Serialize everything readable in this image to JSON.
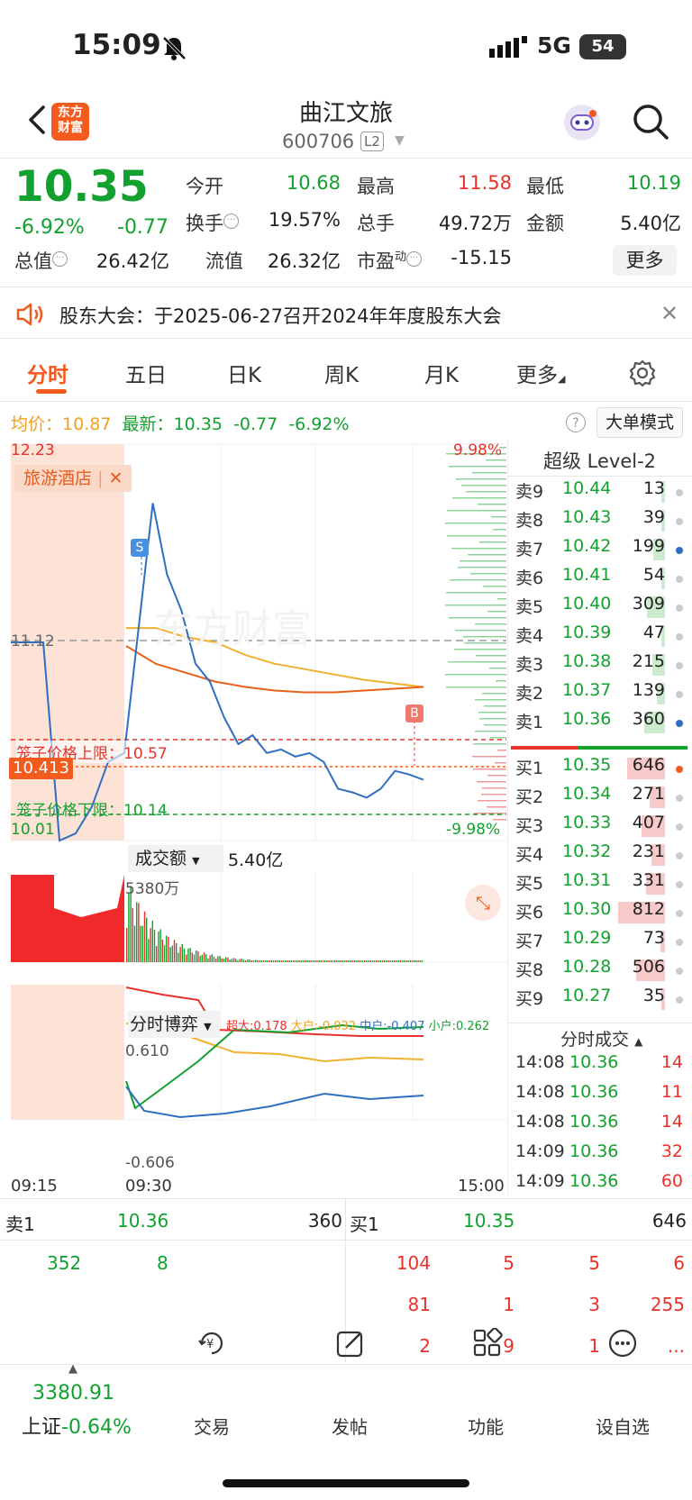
{
  "status_bar": {
    "time": "15:09",
    "network": "5G",
    "battery": "54"
  },
  "header": {
    "logo": "东方\n财富",
    "name": "曲江文旅",
    "code": "600706",
    "level_badge": "L2"
  },
  "quote": {
    "price": "10.35",
    "change_pct": "-6.92%",
    "change_abs": "-0.77",
    "open_label": "今开",
    "open": "10.68",
    "high_label": "最高",
    "high": "11.58",
    "low_label": "最低",
    "low": "10.19",
    "turnover_label": "换手",
    "turnover": "19.57%",
    "volume_label": "总手",
    "volume": "49.72万",
    "amount_label": "金额",
    "amount": "5.40亿",
    "mktcap_label": "总值",
    "mktcap": "26.42亿",
    "float_label": "流值",
    "float_cap": "26.32亿",
    "pe_label": "市盈",
    "pe_sup": "动",
    "pe": "-15.15",
    "more_label": "更多"
  },
  "notice": {
    "text": "股东大会：于2025-06-27召开2024年年度股东大会"
  },
  "tabs": [
    "分时",
    "五日",
    "日K",
    "周K",
    "月K",
    "更多"
  ],
  "active_tab": 0,
  "info_line": {
    "avg_label": "均价：",
    "avg": "10.87",
    "latest_label": "最新：",
    "latest": "10.35",
    "chg": "-0.77",
    "pct": "-6.92%",
    "big_order_mode": "大单模式"
  },
  "chart": {
    "y_top": "12.23",
    "y_bottom": "10.01",
    "ref_price": "11.12",
    "cur_tag": "10.413",
    "pct_top": "9.98%",
    "pct_bottom": "-9.98%",
    "cage_upper": "笼子价格上限：10.57",
    "cage_lower": "笼子价格下限：10.14",
    "sector_tag": "旅游酒店",
    "marker_s": "S",
    "marker_b": "B",
    "volume_title": "成交额",
    "volume_total": "5.40亿",
    "volume_max": "5380万",
    "game_title": "分时博弈",
    "game_legend": {
      "super": "超大:0.178",
      "large": "大户:-0.032",
      "mid": "中户:-0.407",
      "small": "小户:0.262"
    },
    "game_top": "0.610",
    "game_bottom": "-0.606",
    "time_start": "09:15",
    "time_open": "09:30",
    "time_end": "15:00"
  },
  "chart_data": {
    "type": "line",
    "title": "",
    "xlabel": "",
    "ylabel": "",
    "x_range": [
      "09:15",
      "15:00"
    ],
    "ylim": [
      10.01,
      12.23
    ],
    "series": [
      {
        "name": "",
        "color": "#2f6fc2",
        "values": [
          11.12,
          11.12,
          11.12,
          10.01,
          10.05,
          10.2,
          10.45,
          10.5,
          11.2,
          11.9,
          11.5,
          11.3,
          11.0,
          10.9,
          10.7,
          10.55,
          10.6,
          10.5,
          10.52,
          10.48,
          10.5,
          10.45,
          10.3,
          10.28,
          10.25,
          10.3,
          10.4,
          10.38,
          10.35
        ]
      },
      {
        "name": "",
        "color": "#f0b030",
        "values": [
          11.2,
          11.2,
          11.15,
          11.12,
          11.05,
          11.0,
          10.97,
          10.94,
          10.91,
          10.89,
          10.87
        ]
      },
      {
        "name": "",
        "color": "#e8601a",
        "values": [
          11.1,
          11.0,
          10.95,
          10.9,
          10.87,
          10.85,
          10.84,
          10.84,
          10.85,
          10.86,
          10.87
        ]
      }
    ]
  },
  "level2": {
    "title": "超级 Level-2",
    "asks": [
      {
        "label": "卖9",
        "price": "10.44",
        "vol": "13",
        "bar": 0.02
      },
      {
        "label": "卖8",
        "price": "10.43",
        "vol": "39",
        "bar": 0.05
      },
      {
        "label": "卖7",
        "price": "10.42",
        "vol": "199",
        "bar": 0.25
      },
      {
        "label": "卖6",
        "price": "10.41",
        "vol": "54",
        "bar": 0.07
      },
      {
        "label": "卖5",
        "price": "10.40",
        "vol": "309",
        "bar": 0.38
      },
      {
        "label": "卖4",
        "price": "10.39",
        "vol": "47",
        "bar": 0.06
      },
      {
        "label": "卖3",
        "price": "10.38",
        "vol": "215",
        "bar": 0.27
      },
      {
        "label": "卖2",
        "price": "10.37",
        "vol": "139",
        "bar": 0.17
      },
      {
        "label": "卖1",
        "price": "10.36",
        "vol": "360",
        "bar": 0.44
      }
    ],
    "bids": [
      {
        "label": "买1",
        "price": "10.35",
        "vol": "646",
        "bar": 0.8
      },
      {
        "label": "买2",
        "price": "10.34",
        "vol": "271",
        "bar": 0.33
      },
      {
        "label": "买3",
        "price": "10.33",
        "vol": "407",
        "bar": 0.5
      },
      {
        "label": "买4",
        "price": "10.32",
        "vol": "231",
        "bar": 0.28
      },
      {
        "label": "买5",
        "price": "10.31",
        "vol": "331",
        "bar": 0.41
      },
      {
        "label": "买6",
        "price": "10.30",
        "vol": "812",
        "bar": 1.0
      },
      {
        "label": "买7",
        "price": "10.29",
        "vol": "73",
        "bar": 0.09
      },
      {
        "label": "买8",
        "price": "10.28",
        "vol": "506",
        "bar": 0.62
      },
      {
        "label": "买9",
        "price": "10.27",
        "vol": "35",
        "bar": 0.04
      }
    ],
    "trades_title": "分时成交",
    "trades": [
      {
        "time": "14:08",
        "price": "10.36",
        "vol": "14"
      },
      {
        "time": "14:08",
        "price": "10.36",
        "vol": "11"
      },
      {
        "time": "14:08",
        "price": "10.36",
        "vol": "14"
      },
      {
        "time": "14:09",
        "price": "10.36",
        "vol": "32"
      },
      {
        "time": "14:09",
        "price": "10.36",
        "vol": "60"
      }
    ]
  },
  "queue": {
    "ask_label": "卖1",
    "ask_price": "10.36",
    "ask_vol": "360",
    "bid_label": "买1",
    "bid_price": "10.35",
    "bid_vol": "646",
    "ask_orders": [
      "352",
      "8"
    ],
    "bid_orders": [
      [
        "104",
        "5",
        "5",
        "6"
      ],
      [
        "81",
        "1",
        "3",
        "255"
      ],
      [
        "2",
        "9",
        "1",
        "..."
      ]
    ]
  },
  "bottom_nav": {
    "index_value": "3380.91",
    "index_name": "上证",
    "index_pct": "-0.64%",
    "items": [
      "交易",
      "发帖",
      "功能",
      "设自选"
    ]
  }
}
